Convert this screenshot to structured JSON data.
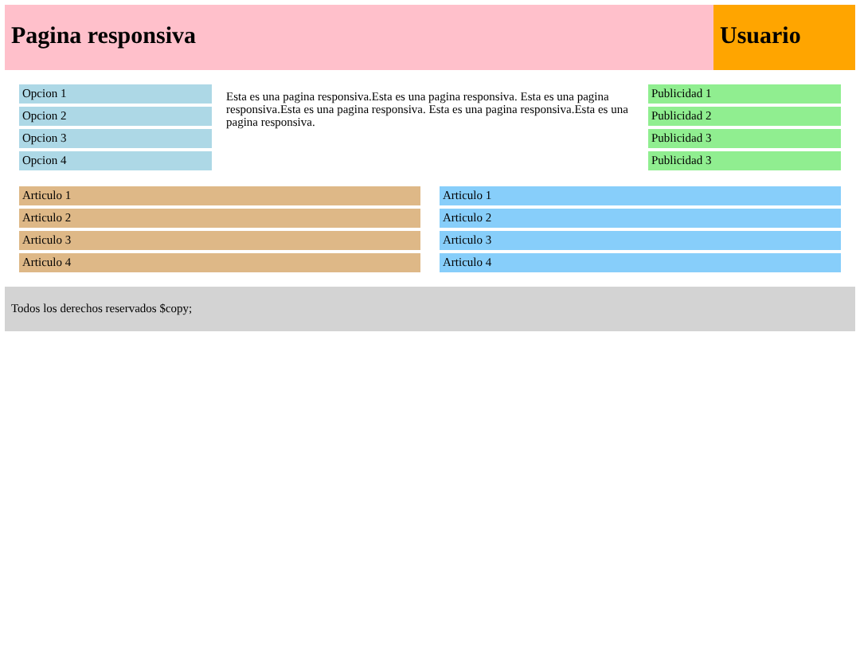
{
  "header": {
    "title": "Pagina responsiva",
    "user": "Usuario"
  },
  "menu": [
    "Opcion 1",
    "Opcion 2",
    "Opcion 3",
    "Opcion 4"
  ],
  "content": "Esta es una pagina responsiva.Esta es una pagina responsiva. Esta es una pagina responsiva.Esta es una pagina responsiva. Esta es una pagina responsiva.Esta es una pagina responsiva.",
  "ads": [
    "Publicidad 1",
    "Publicidad 2",
    "Publicidad 3",
    "Publicidad 3"
  ],
  "articles_left": [
    "Articulo 1",
    "Articulo 2",
    "Articulo 3",
    "Articulo 4"
  ],
  "articles_right": [
    "Articulo 1",
    "Articulo 2",
    "Articulo 3",
    "Articulo 4"
  ],
  "footer": "Todos los derechos reservados $copy;"
}
